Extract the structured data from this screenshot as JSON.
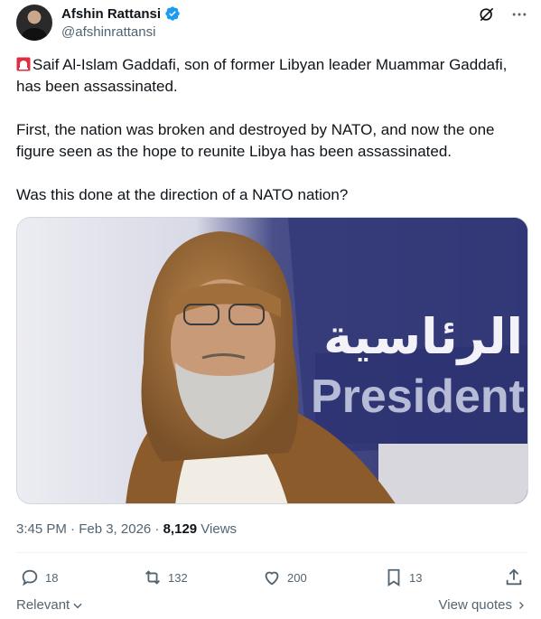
{
  "author": {
    "display_name": "Afshin Rattansi",
    "handle": "@afshinrattansi",
    "verified": true,
    "verified_color": "#1d9bf0"
  },
  "top_actions": [
    "grok-icon",
    "more-icon"
  ],
  "tweet": {
    "paragraph1": "Saif Al-Islam Gaddafi, son of former Libyan leader Muammar Gaddafi, has been assassinated.",
    "paragraph2": "First, the nation was broken and destroyed by NATO, and now the one figure seen as the hope to reunite Libya has been assassinated.",
    "paragraph3": "Was this done at the direction of a NATO nation?",
    "leading_emoji": "police-light-icon"
  },
  "media": {
    "sign_arabic": "الرئاسية",
    "sign_latin": "Presidenti"
  },
  "meta": {
    "time": "3:45 PM · Feb 3, 2026 · ",
    "views_count": "8,129",
    "views_label": " Views"
  },
  "actions": {
    "replies": "18",
    "reposts": "132",
    "likes": "200",
    "bookmarks": "13"
  },
  "footer": {
    "sort_label": "Relevant",
    "view_quotes_label": "View quotes"
  }
}
